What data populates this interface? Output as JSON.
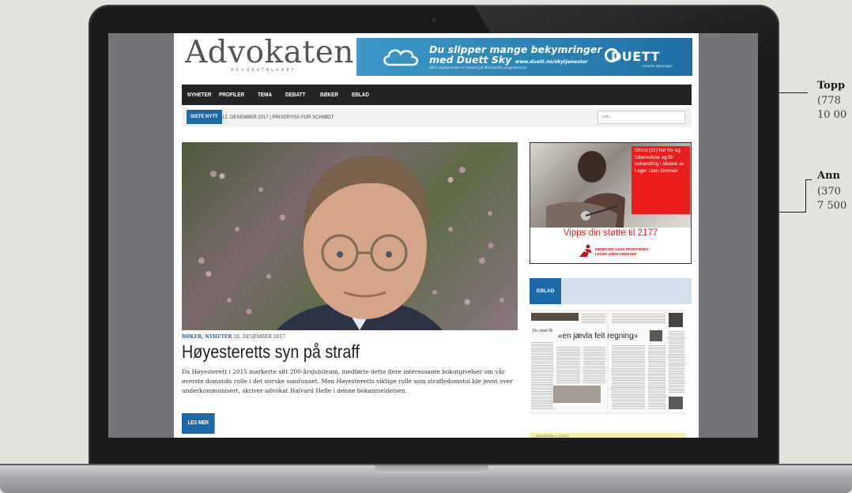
{
  "site": {
    "logo": {
      "word": "Advokaten",
      "sub": "ADVOKATBLADET"
    },
    "banner": {
      "line1": "Du slipper mange bekymringer",
      "line2": "med Duett Sky",
      "url": "www.duett.no/skytjenester",
      "small": "Våre skytjenester er basert på Microsofts programvare",
      "brand": "DUETT",
      "brand_tag": "– smarte løsninger"
    },
    "nav": [
      "NYHETER",
      "PROFILER",
      "TEMA",
      "DEBATT",
      "BØKER",
      "EBLAD"
    ],
    "ticker": {
      "badge": "SISTE NYTT",
      "text": "12. DESEMBER 2017 | PRISDRYSS FOR SCHIØDT",
      "search_placeholder": "søk..."
    },
    "article": {
      "categories": "BØKER, NYHETER",
      "date": "18. DESEMBER 2017",
      "title": "Høyesteretts syn på straff",
      "excerpt": "Da Høyesterett i 2015 markerte sitt 200-årsjubileum, medførte dette flere interessante bokutgivelser om vår øverste domstols rolle i det norske samfunnet. Men Høyesteretts viktige rolle som straffedomstol ble jevnt over underkommunisert, skriver advokat Halvard Helle i denne bokanmeldelsen.",
      "read_more": "LES MER"
    },
    "ad": {
      "red_box": "Gloria (11) har hiv og tuberkulose og får behandling i Malawi av Leger Uten Grenser",
      "cta": "Vipps din støtte til 2177",
      "org_line1": "MEDECINS SANS FRONTIERES",
      "org_line2": "LEGER UTEN GRENSER"
    },
    "eblad": {
      "tab": "EBLAD",
      "pretitle": "Du skal få",
      "headline": "«en jævla feit regning»"
    },
    "yellow_label": "ADVOKATEN nr. 10/2017"
  },
  "callouts": [
    {
      "title": "Topp",
      "dims": "(778",
      "price": "10 00"
    },
    {
      "title": "Ann",
      "dims": "(370",
      "price": "7 500"
    }
  ],
  "colors": {
    "accent_blue": "#1b6aa6",
    "nav_bg": "#232323",
    "ad_red": "#ea1c1c"
  }
}
